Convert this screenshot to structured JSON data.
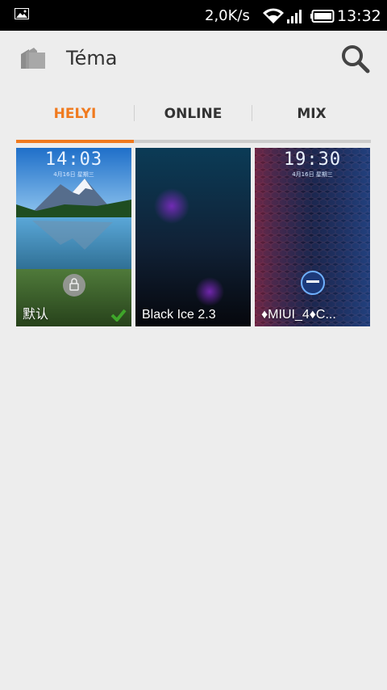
{
  "status_bar": {
    "speed": "2,0K/s",
    "time": "13:32",
    "icons": [
      "image-icon",
      "wifi-icon",
      "signal-icon",
      "battery-icon"
    ]
  },
  "header": {
    "title": "Téma",
    "icons": [
      "theme-folder-icon",
      "search-icon"
    ]
  },
  "tabs": [
    {
      "label": "HELYI",
      "active": true
    },
    {
      "label": "ONLINE",
      "active": false
    },
    {
      "label": "MIX",
      "active": false
    }
  ],
  "colors": {
    "accent": "#f07a1e",
    "background": "#ededed",
    "check": "#3fa62a"
  },
  "themes": [
    {
      "name": "默认",
      "clock": "14:03",
      "date": "4月16日 星期三",
      "selected": true
    },
    {
      "name": "Black Ice 2.3",
      "selected": false
    },
    {
      "name": "♦MIUI_4♦C...",
      "clock": "19:30",
      "date": "4月16日 星期三",
      "selected": false
    }
  ]
}
